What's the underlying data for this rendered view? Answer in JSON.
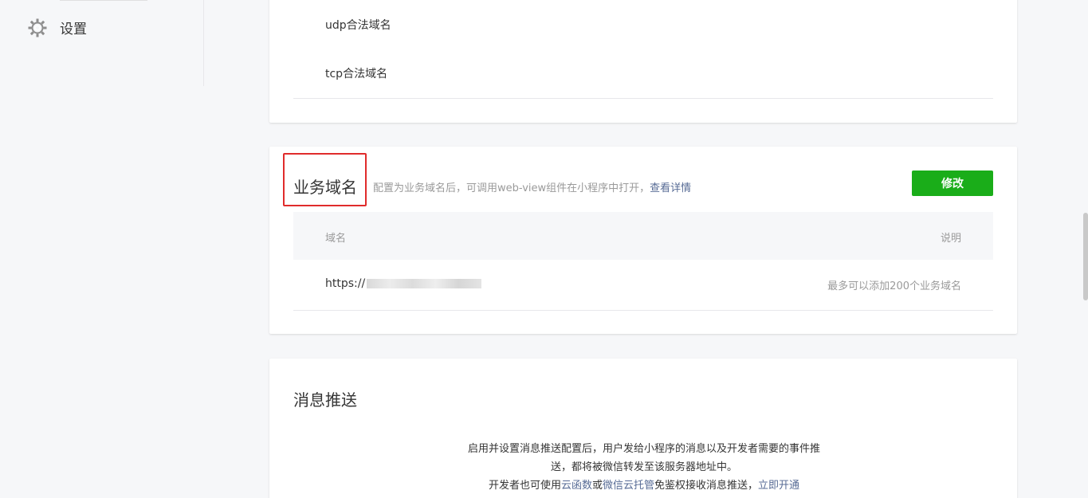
{
  "sidebar": {
    "settings": {
      "label": "设置",
      "icon": "gear-icon"
    }
  },
  "server_domains": {
    "udp_label": "udp合法域名",
    "tcp_label": "tcp合法域名"
  },
  "business_domain": {
    "title": "业务域名",
    "desc_prefix": "配置为业务域名后，可调用web-view组件在小程序中打开，",
    "desc_link": "查看详情",
    "edit_button": "修改",
    "table": {
      "headers": {
        "domain": "域名",
        "desc": "说明"
      },
      "rows": [
        {
          "domain": "https://",
          "desc": "最多可以添加200个业务域名"
        }
      ]
    }
  },
  "message_push": {
    "title": "消息推送",
    "line1": "启用并设置消息推送配置后，用户发给小程序的消息以及开发者需要的事件推",
    "line2": "送，都将被微信转发至该服务器地址中。",
    "line3_prefix": "开发者也可使用",
    "link_cloud_function": "云函数",
    "or": "或",
    "link_cloud_hosting": "微信云托管",
    "line3_mid": "免鉴权接收消息推送，",
    "link_enable": "立即开通"
  },
  "colors": {
    "primary_green": "#1aad19",
    "link_blue": "#576b95",
    "highlight_red": "#e02b2b"
  }
}
